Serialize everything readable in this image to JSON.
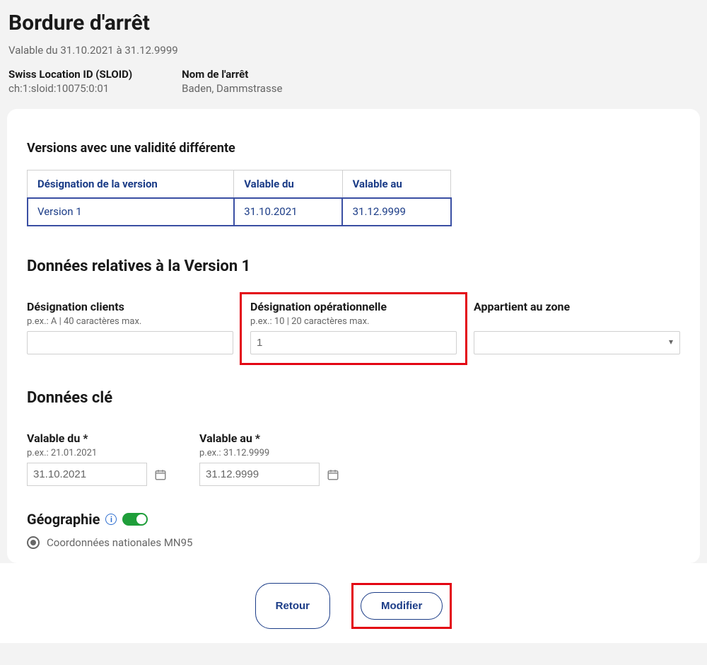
{
  "header": {
    "title": "Bordure d'arrêt",
    "validity": "Valable du 31.10.2021 à 31.12.9999",
    "sloid_label": "Swiss Location ID (SLOID)",
    "sloid_value": "ch:1:sloid:10075:0:01",
    "stop_name_label": "Nom de l'arrêt",
    "stop_name_value": "Baden, Dammstrasse"
  },
  "versions": {
    "section_title": "Versions avec une validité différente",
    "cols": {
      "designation": "Désignation de la version",
      "from": "Valable du",
      "to": "Valable au"
    },
    "rows": [
      {
        "designation": "Version 1",
        "from": "31.10.2021",
        "to": "31.12.9999"
      }
    ]
  },
  "version_data": {
    "section_title": "Données relatives à la Version 1",
    "client_designation": {
      "label": "Désignation clients",
      "hint": "p.ex.: A | 40 caractères max.",
      "value": ""
    },
    "operational_designation": {
      "label": "Désignation opérationnelle",
      "hint": "p.ex.: 10 | 20 caractères max.",
      "value": "1"
    },
    "zone": {
      "label": "Appartient au zone",
      "value": ""
    }
  },
  "key_data": {
    "section_title": "Données clé",
    "valid_from": {
      "label": "Valable du *",
      "hint": "p.ex.: 21.01.2021",
      "value": "31.10.2021"
    },
    "valid_to": {
      "label": "Valable au *",
      "hint": "p.ex.: 31.12.9999",
      "value": "31.12.9999"
    }
  },
  "geography": {
    "title": "Géographie",
    "coord_label": "Coordonnées nationales MN95"
  },
  "footer": {
    "back": "Retour",
    "modify": "Modifier"
  }
}
